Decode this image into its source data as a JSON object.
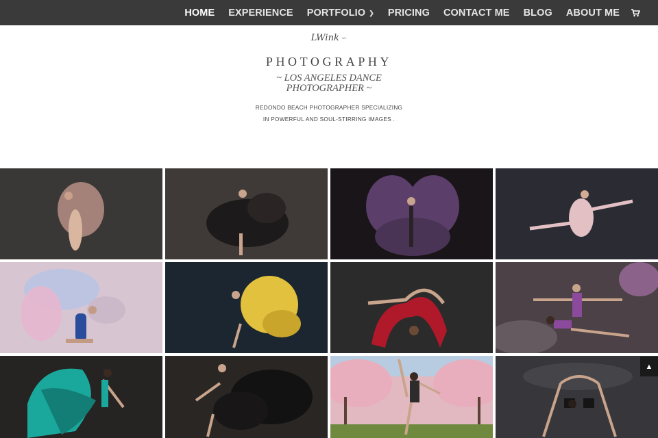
{
  "nav": {
    "items": [
      {
        "label": "HOME",
        "active": true
      },
      {
        "label": "EXPERIENCE"
      },
      {
        "label": "PORTFOLIO",
        "has_dropdown": true
      },
      {
        "label": "PRICING"
      },
      {
        "label": "CONTACT ME"
      },
      {
        "label": "BLOG"
      },
      {
        "label": "ABOUT ME"
      }
    ],
    "cart_icon": "shopping-cart-icon"
  },
  "header": {
    "logo_script": "LWink",
    "logo_title": "PHOTOGRAPHY",
    "tagline_line1": "~ LOS ANGELES DANCE",
    "tagline_line2": "PHOTOGRAPHER ~",
    "desc_line1": "REDONDO BEACH PHOTOGRAPHER SPECIALIZING",
    "desc_line2": "IN POWERFUL AND SOUL-STIRRING IMAGES ."
  },
  "gallery": {
    "photos": [
      {
        "bg": "#3a3836",
        "accent": "#b78f86",
        "subject": "dancer-pink-fabric"
      },
      {
        "bg": "#3f3a37",
        "accent": "#1c1a1a",
        "subject": "dancer-black-dress"
      },
      {
        "bg": "#1a1518",
        "accent": "#5b3f6a",
        "subject": "dancer-purple-wings"
      },
      {
        "bg": "#2b2b33",
        "accent": "#e2c0c4",
        "subject": "dancer-pink-tutu-leap"
      },
      {
        "bg": "#d7c6d1",
        "accent": "#2a4c9c",
        "subject": "dancer-powder-cloud"
      },
      {
        "bg": "#1b2630",
        "accent": "#e2c13e",
        "subject": "dancer-yellow-skirt"
      },
      {
        "bg": "#2c2b2b",
        "accent": "#b0192a",
        "subject": "dancers-red-fabric"
      },
      {
        "bg": "#4b4147",
        "accent": "#8c4a9c",
        "subject": "two-dancers-purple"
      },
      {
        "bg": "#262422",
        "accent": "#1aa89d",
        "subject": "dancer-teal-dress"
      },
      {
        "bg": "#2a2624",
        "accent": "#121212",
        "subject": "dancer-black-skirt"
      },
      {
        "bg": "#e2b9c1",
        "accent": "#2c2c2c",
        "subject": "dancer-cherry-blossoms"
      },
      {
        "bg": "#37373b",
        "accent": "#151515",
        "subject": "two-dancers-black"
      }
    ]
  },
  "scroll_top_icon": "chevron-up-icon"
}
